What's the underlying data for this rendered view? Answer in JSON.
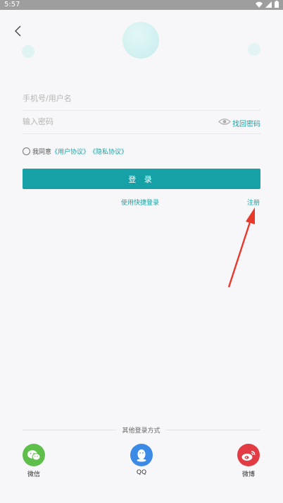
{
  "status_bar": {
    "time": "5:57"
  },
  "icons": {
    "back": "back-chevron-icon",
    "eye": "eye-icon",
    "wechat": "wechat-icon",
    "qq": "qq-icon",
    "weibo": "weibo-icon"
  },
  "form": {
    "username_placeholder": "手机号/用户名",
    "password_placeholder": "输入密码",
    "find_password": "找回密码"
  },
  "agreement": {
    "prefix": "我同意",
    "user_agreement": "《用户协议》",
    "privacy_agreement": "《隐私协议》"
  },
  "login_button": "登 录",
  "quick_login": "使用快捷登录",
  "register": "注册",
  "other_login": {
    "label": "其他登录方式",
    "options": [
      {
        "label": "微信"
      },
      {
        "label": "QQ"
      },
      {
        "label": "微博"
      }
    ]
  },
  "colors": {
    "accent": "#16a1a6",
    "annotation_arrow": "#e8392c"
  }
}
